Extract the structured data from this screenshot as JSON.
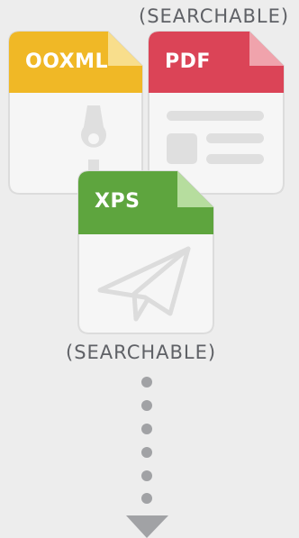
{
  "labels": {
    "top": "(SEARCHABLE)",
    "middle": "(SEARCHABLE)"
  },
  "documents": [
    {
      "label": "OOXML",
      "color": "#f0b826",
      "icon": "zipper-icon"
    },
    {
      "label": "PDF",
      "color": "#db4457",
      "icon": "document-lines-icon"
    },
    {
      "label": "XPS",
      "color": "#5ea53e",
      "icon": "paper-plane-icon"
    }
  ],
  "flow": {
    "connector": "dotted-arrow",
    "dot_color": "#a1a2a5"
  }
}
